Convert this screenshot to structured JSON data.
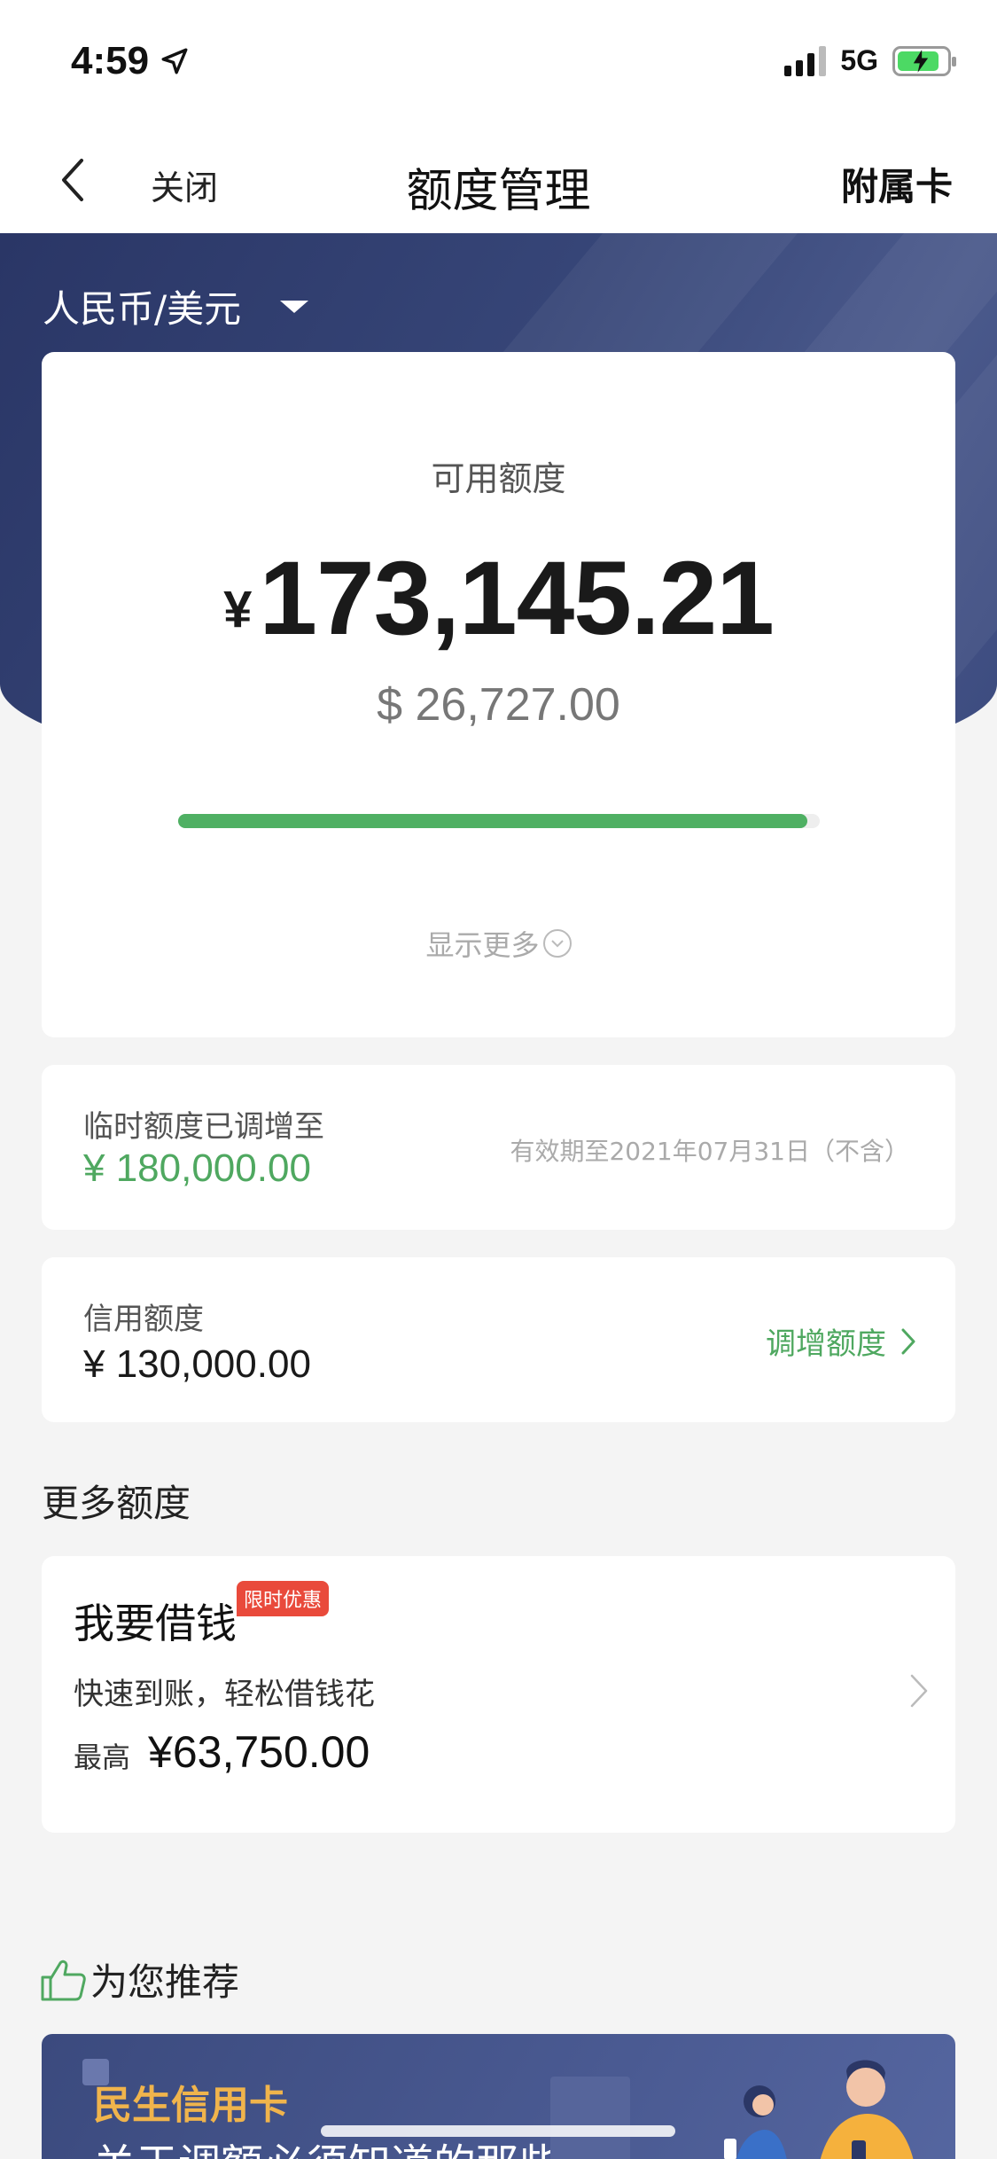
{
  "status": {
    "time": "4:59",
    "network": "5G"
  },
  "nav": {
    "close": "关闭",
    "title": "额度管理",
    "right": "附属卡"
  },
  "currency": {
    "selected": "人民币/美元"
  },
  "available": {
    "label": "可用额度",
    "currency_symbol": "¥",
    "amount": "173,145.21",
    "usd": "$ 26,727.00",
    "progress_percent": 98,
    "show_more": "显示更多"
  },
  "temporary": {
    "label": "临时额度已调增至",
    "amount": "¥ 180,000.00",
    "validity": "有效期至2021年07月31日（不含）"
  },
  "credit": {
    "label": "信用额度",
    "amount": "¥ 130,000.00",
    "action": "调增额度"
  },
  "more": {
    "title": "更多额度",
    "loan": {
      "title": "我要借钱",
      "badge": "限时优惠",
      "subtitle": "快速到账，轻松借钱花",
      "max_label": "最高",
      "max_amount": "¥63,750.00"
    }
  },
  "recommend": {
    "title": "为您推荐",
    "banner": {
      "brand": "民生信用卡",
      "text": "关于调额必须知道的那些事"
    }
  },
  "colors": {
    "accent_green": "#4fa860",
    "banner_navy": "#364577",
    "badge_red": "#e94a3b",
    "promo_gold": "#f0b44c"
  }
}
